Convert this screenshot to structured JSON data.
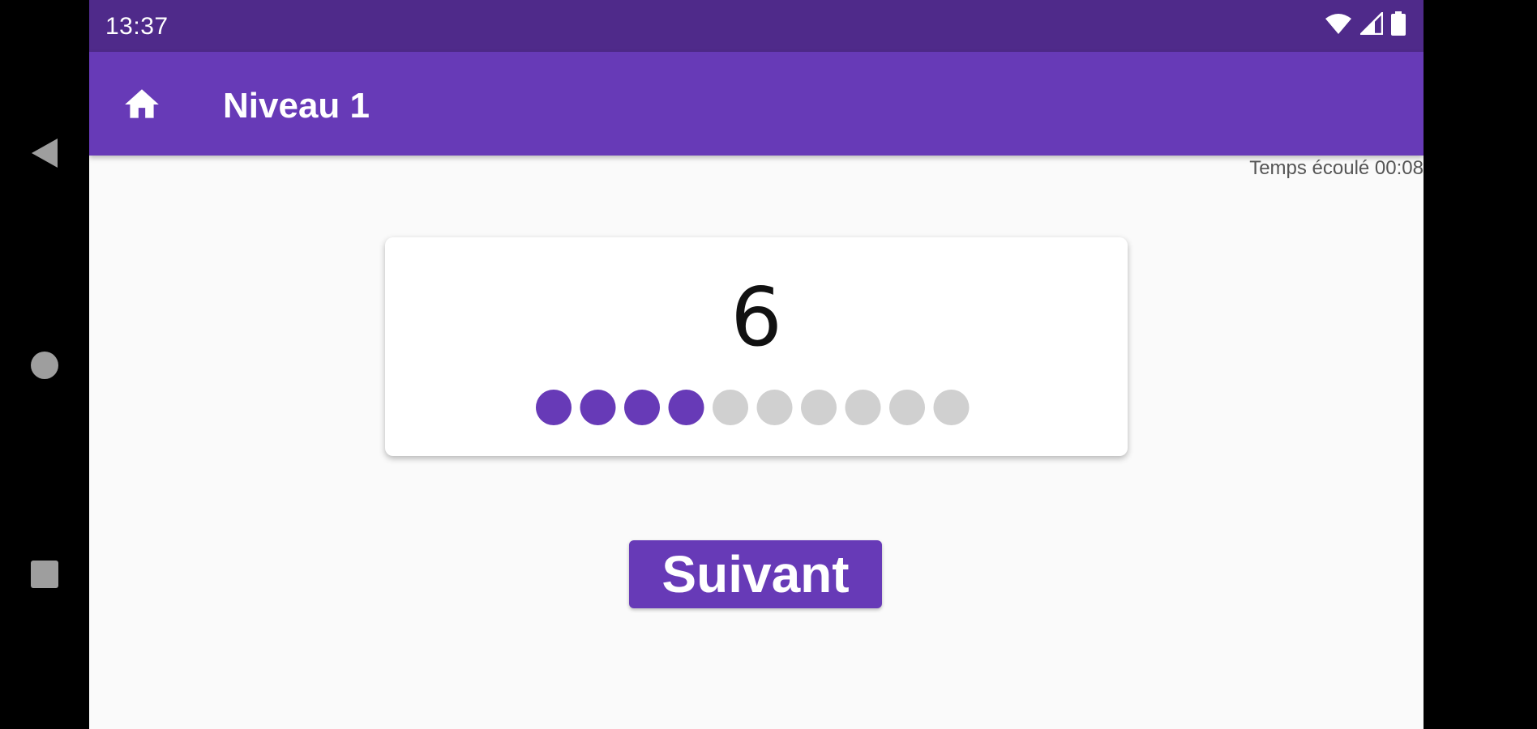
{
  "status_bar": {
    "time": "13:37",
    "icons": [
      "wifi-icon",
      "signal-icon",
      "battery-icon"
    ]
  },
  "app_bar": {
    "title": "Niveau 1",
    "home_icon": "home-icon",
    "color": "#673ab7",
    "status_color": "#4f2a8a"
  },
  "timer": {
    "text": "Temps écoulé 00:08"
  },
  "card": {
    "number": "6",
    "dots_total": 10,
    "dots_filled": 4,
    "filled_color": "#673ab7",
    "empty_color": "#d0d0d0"
  },
  "next_button": {
    "label": "Suivant"
  },
  "system_nav": {
    "icons": [
      "back-icon",
      "home-circle-icon",
      "recents-icon"
    ]
  }
}
